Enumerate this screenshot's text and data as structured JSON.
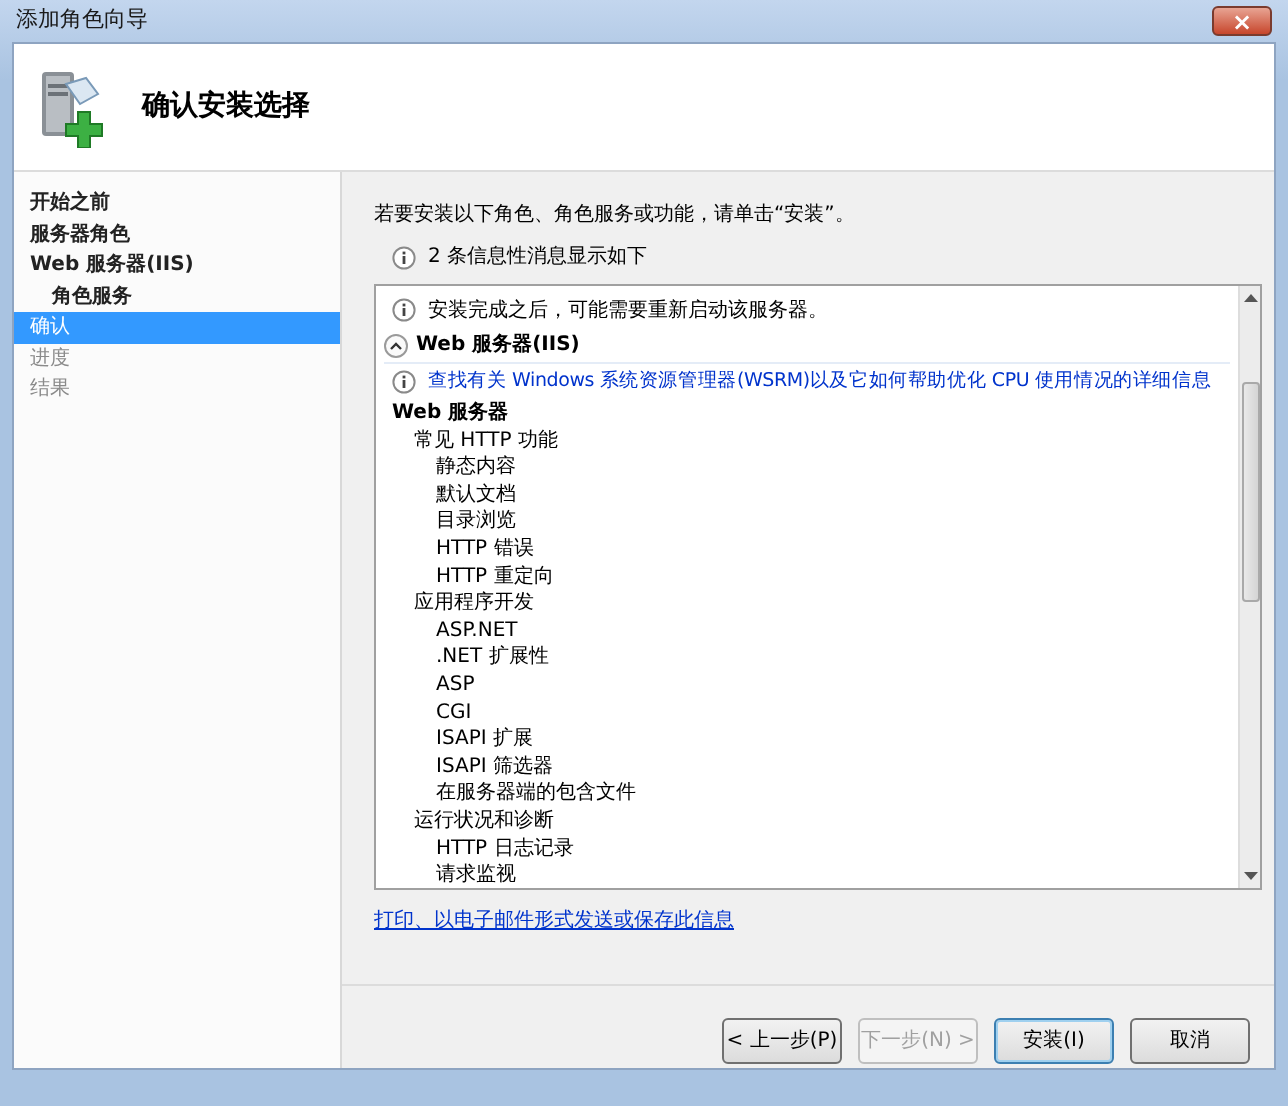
{
  "window": {
    "title": "添加角色向导",
    "close": "×"
  },
  "header": {
    "title": "确认安装选择"
  },
  "sidebar": {
    "items": [
      {
        "label": "开始之前",
        "selected": false,
        "disabled": false
      },
      {
        "label": "服务器角色",
        "selected": false,
        "disabled": false
      },
      {
        "label": "Web 服务器(IIS)",
        "selected": false,
        "disabled": false,
        "children": [
          {
            "label": "角色服务",
            "selected": false,
            "disabled": false
          }
        ]
      },
      {
        "label": "确认",
        "selected": true,
        "disabled": false
      },
      {
        "label": "进度",
        "selected": false,
        "disabled": true
      },
      {
        "label": "结果",
        "selected": false,
        "disabled": true
      }
    ]
  },
  "instruction": "若要安装以下角色、角色服务或功能，请单击“安装”。",
  "info_summary": "2 条信息性消息显示如下",
  "details": {
    "notice": "安装完成之后，可能需要重新启动该服务器。",
    "section": {
      "title": "Web 服务器(IIS)",
      "expanded": true,
      "link": "查找有关 Windows 系统资源管理器(WSRM)以及它如何帮助优化 CPU 使用情况的详细信息",
      "tree": [
        {
          "label": "Web 服务器",
          "children": [
            {
              "label": "常见 HTTP 功能",
              "children": [
                {
                  "label": "静态内容"
                },
                {
                  "label": "默认文档"
                },
                {
                  "label": "目录浏览"
                },
                {
                  "label": "HTTP 错误"
                },
                {
                  "label": "HTTP 重定向"
                }
              ]
            },
            {
              "label": "应用程序开发",
              "children": [
                {
                  "label": "ASP.NET"
                },
                {
                  "label": ".NET 扩展性"
                },
                {
                  "label": "ASP"
                },
                {
                  "label": "CGI"
                },
                {
                  "label": "ISAPI 扩展"
                },
                {
                  "label": "ISAPI 筛选器"
                },
                {
                  "label": "在服务器端的包含文件"
                }
              ]
            },
            {
              "label": "运行状况和诊断",
              "children": [
                {
                  "label": "HTTP 日志记录"
                },
                {
                  "label": "请求监视"
                }
              ]
            }
          ]
        }
      ]
    }
  },
  "save_link": "打印、以电子邮件形式发送或保存此信息",
  "buttons": [
    {
      "label": "< 上一步(P)",
      "disabled": false,
      "default": false
    },
    {
      "label": "下一步(N) >",
      "disabled": true,
      "default": false
    },
    {
      "label": "安装(I)",
      "disabled": false,
      "default": true
    },
    {
      "label": "取消",
      "disabled": false,
      "default": false
    }
  ]
}
